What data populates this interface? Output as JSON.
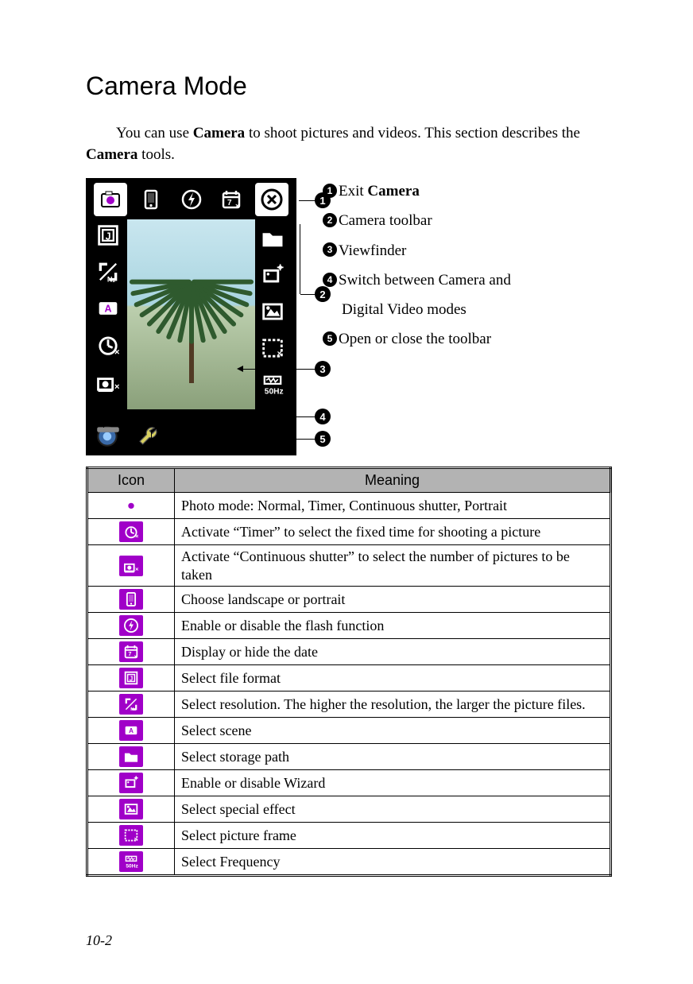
{
  "title": "Camera Mode",
  "intro_prefix": "You can use ",
  "intro_bold1": "Camera",
  "intro_mid": " to shoot pictures and videos. This section describes the ",
  "intro_bold2": "Camera",
  "intro_suffix": " tools.",
  "callouts": {
    "c1": {
      "num": "1",
      "prefix": "Exit ",
      "bold": "Camera"
    },
    "c2": {
      "num": "2",
      "text": "Camera toolbar"
    },
    "c3": {
      "num": "3",
      "text": "Viewfinder"
    },
    "c4": {
      "num": "4",
      "text": "Switch between Camera and",
      "cont": "Digital Video modes"
    },
    "c5": {
      "num": "5",
      "text": "Open or close the toolbar"
    }
  },
  "table": {
    "header_icon": "Icon",
    "header_meaning": "Meaning",
    "rows": [
      {
        "icon": "photo-mode-icon",
        "meaning": "Photo mode: Normal, Timer, Continuous shutter, Portrait"
      },
      {
        "icon": "timer-icon",
        "meaning": "Activate “Timer” to select the fixed time for shooting a picture"
      },
      {
        "icon": "continuous-shutter-icon",
        "meaning": "Activate “Continuous shutter” to select the number of pictures to be taken"
      },
      {
        "icon": "orientation-icon",
        "meaning": "Choose landscape or portrait"
      },
      {
        "icon": "flash-icon",
        "meaning": "Enable or disable the flash function"
      },
      {
        "icon": "date-icon",
        "meaning": "Display or hide the date"
      },
      {
        "icon": "file-format-icon",
        "meaning": "Select file format"
      },
      {
        "icon": "resolution-icon",
        "meaning": "Select resolution. The higher the resolution, the larger the picture files."
      },
      {
        "icon": "scene-icon",
        "meaning": "Select scene"
      },
      {
        "icon": "storage-path-icon",
        "meaning": "Select storage path"
      },
      {
        "icon": "wizard-icon",
        "meaning": "Enable or disable Wizard"
      },
      {
        "icon": "special-effect-icon",
        "meaning": "Select special effect"
      },
      {
        "icon": "picture-frame-icon",
        "meaning": "Select picture frame"
      },
      {
        "icon": "frequency-icon",
        "meaning": "Select Frequency"
      }
    ]
  },
  "page_number": "10-2"
}
